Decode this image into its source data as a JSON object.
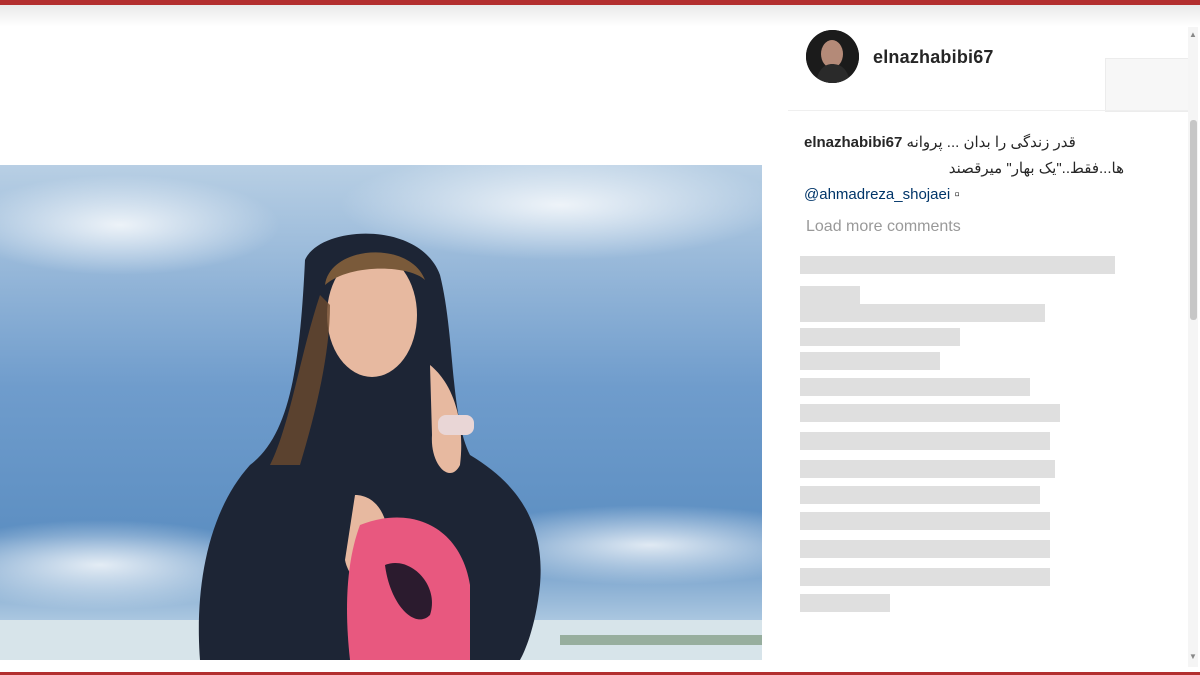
{
  "post": {
    "username": "elnazhabibi67",
    "caption_user": "elnazhabibi67",
    "caption_line1": "قدر زندگی را بدان ... پروانه",
    "caption_line2": "ها...فقط..\"یک بهار\" میرقصند",
    "caption_mention": "@ahmadreza_shojaei",
    "caption_trailing_glyph": "▫",
    "load_more_label": "Load more comments"
  },
  "colors": {
    "accent_bar": "#b32f2f",
    "username": "#262626",
    "mention": "#003569",
    "muted": "#999999"
  },
  "icons": {
    "avatar": "profile-avatar",
    "scroll_up": "scroll-up-arrow",
    "scroll_down": "scroll-down-arrow"
  }
}
